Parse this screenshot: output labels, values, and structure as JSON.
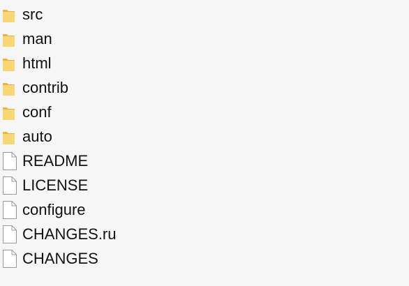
{
  "explorer": {
    "items": [
      {
        "name": "src",
        "type": "folder"
      },
      {
        "name": "man",
        "type": "folder"
      },
      {
        "name": "html",
        "type": "folder"
      },
      {
        "name": "contrib",
        "type": "folder"
      },
      {
        "name": "conf",
        "type": "folder"
      },
      {
        "name": "auto",
        "type": "folder"
      },
      {
        "name": "README",
        "type": "file"
      },
      {
        "name": "LICENSE",
        "type": "file"
      },
      {
        "name": "configure",
        "type": "file"
      },
      {
        "name": "CHANGES.ru",
        "type": "file"
      },
      {
        "name": "CHANGES",
        "type": "file"
      }
    ]
  },
  "colors": {
    "background": "#f6f6f6",
    "folder_front": "#f8d775",
    "folder_back": "#e8b44a",
    "file_outline": "#9a9a9a",
    "text": "#111111"
  },
  "icons": {
    "folder": "folder-icon",
    "file": "file-icon"
  }
}
